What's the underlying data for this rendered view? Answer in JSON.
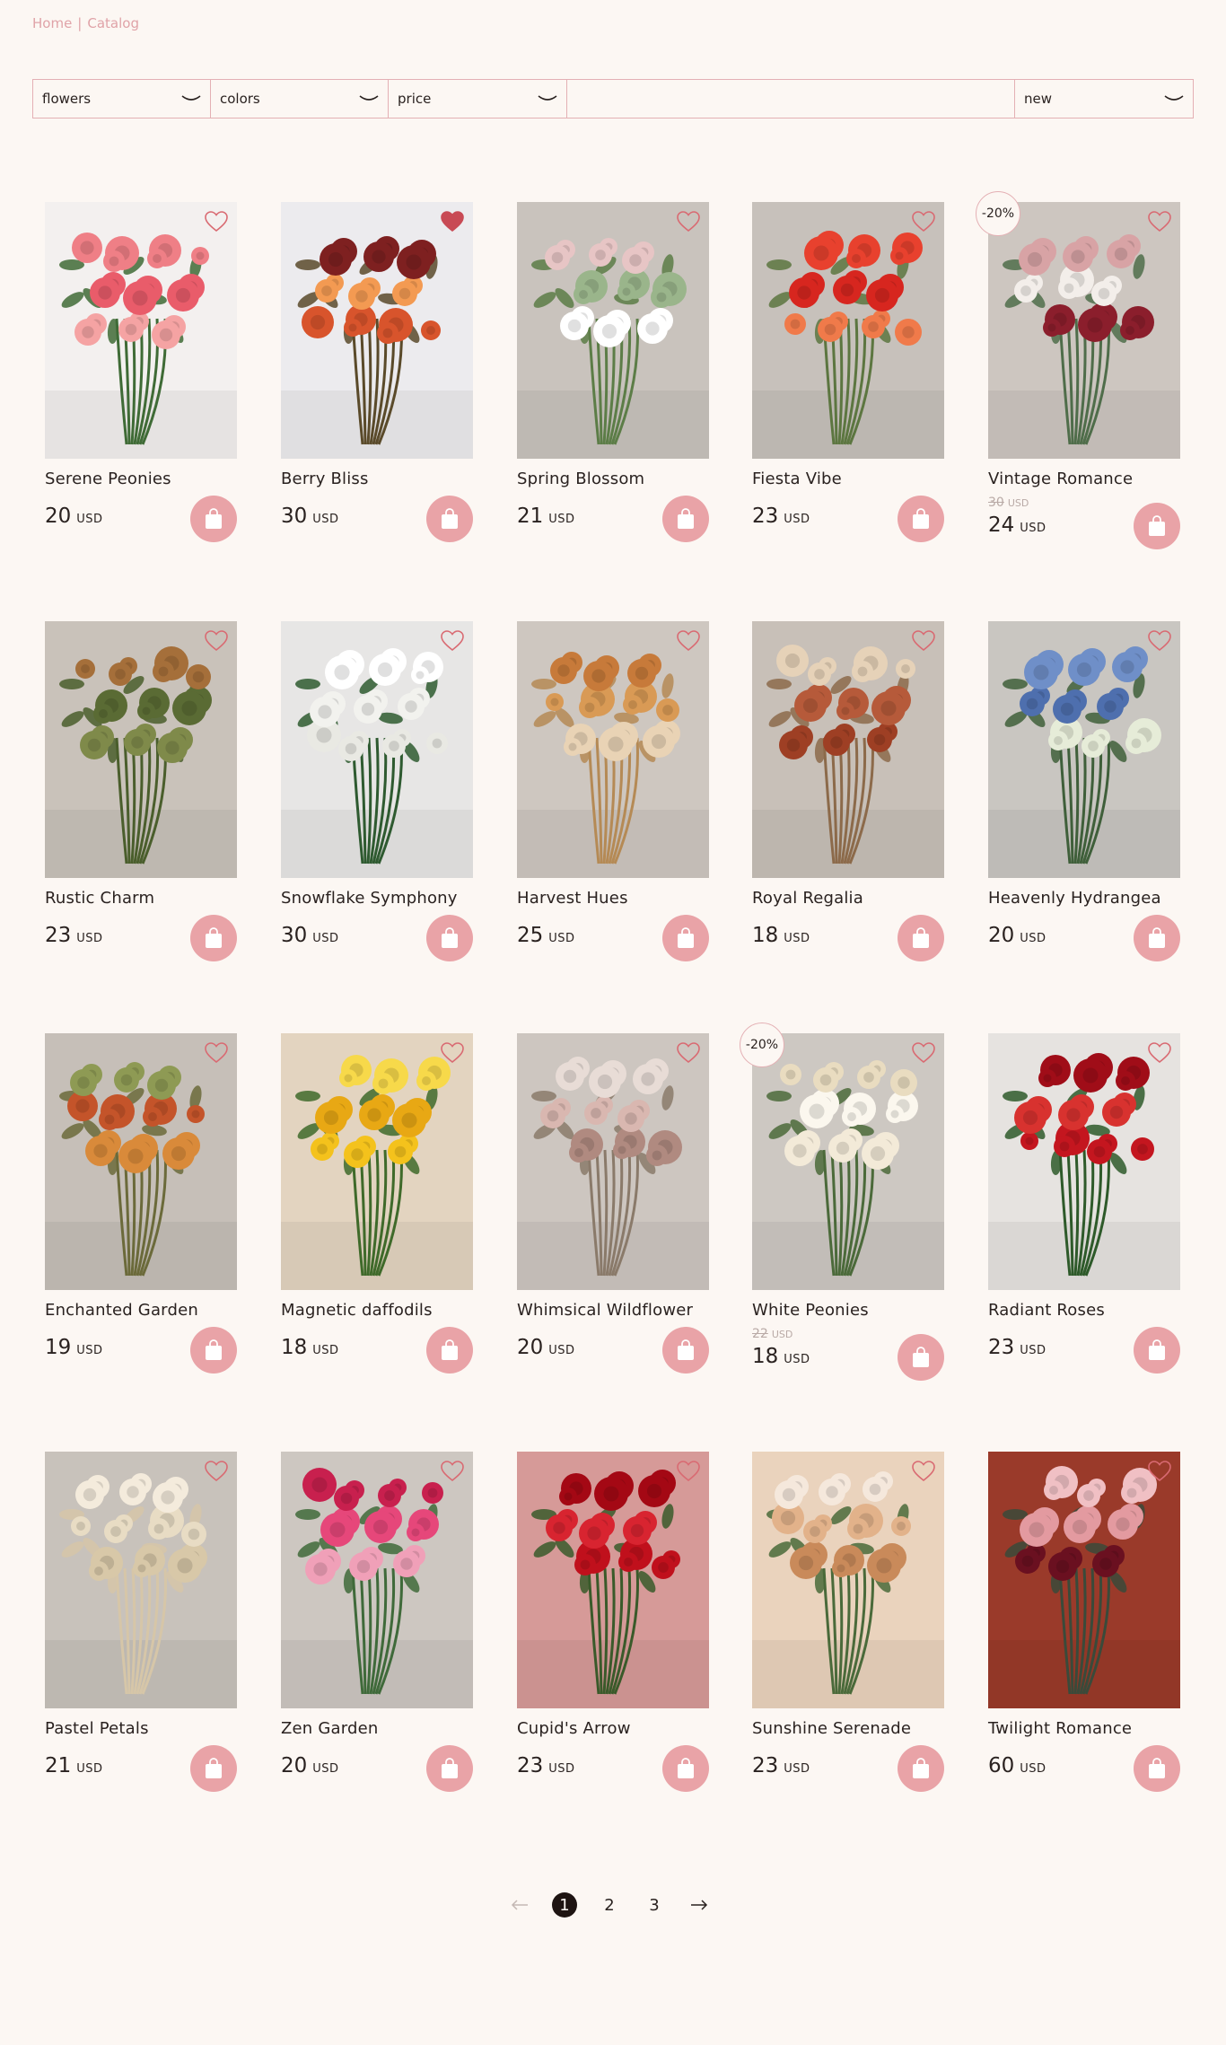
{
  "breadcrumb": {
    "home": "Home",
    "separator": "|",
    "current": "Catalog"
  },
  "filters": {
    "flowers": "flowers",
    "colors": "colors",
    "price": "price",
    "sort": "new"
  },
  "colors": {
    "accent": "#e9a3a7",
    "border": "#e4b0b4",
    "background": "#fcf7f3",
    "text": "#2a2220",
    "heart_filled": "#c84a55"
  },
  "currency": "USD",
  "products": [
    {
      "name": "Serene Peonies",
      "price": "20",
      "liked": false,
      "bg": "#f3f0ef",
      "bloom": [
        "#ef7f86",
        "#e95c6a",
        "#f5a3a3"
      ],
      "leaf": "#3f6b36"
    },
    {
      "name": "Berry Bliss",
      "price": "30",
      "liked": true,
      "bg": "#ecebee",
      "bloom": [
        "#f39a52",
        "#d8542c",
        "#7e2020"
      ],
      "leaf": "#5a4a2a"
    },
    {
      "name": "Spring Blossom",
      "price": "21",
      "liked": false,
      "bg": "#c9c3bd",
      "bloom": [
        "#ffffff",
        "#e7c5c5",
        "#9ab58b"
      ],
      "leaf": "#5c7d47"
    },
    {
      "name": "Fiesta Vibe",
      "price": "23",
      "liked": false,
      "bg": "#c7c1bb",
      "bloom": [
        "#e8412e",
        "#d7261f",
        "#f07a4a"
      ],
      "leaf": "#5c7640"
    },
    {
      "name": "Vintage Romance",
      "price": "24",
      "old_price": "30",
      "discount": "-20%",
      "liked": false,
      "bg": "#cdc6c0",
      "bloom": [
        "#f3eeea",
        "#8b1e2c",
        "#d8a3a5"
      ],
      "leaf": "#4f6d4a"
    },
    {
      "name": "Rustic Charm",
      "price": "23",
      "liked": false,
      "bg": "#c9c2ba",
      "bloom": [
        "#7f8a4a",
        "#a56f3a",
        "#5a6b34"
      ],
      "leaf": "#4a5e2c"
    },
    {
      "name": "Snowflake Symphony",
      "price": "30",
      "liked": false,
      "bg": "#e7e6e5",
      "bloom": [
        "#ffffff",
        "#f2f2ee",
        "#e9e9e3"
      ],
      "leaf": "#2e5a30"
    },
    {
      "name": "Harvest Hues",
      "price": "25",
      "liked": false,
      "bg": "#cec7c0",
      "bloom": [
        "#d99a55",
        "#e9d3b5",
        "#c77a3a"
      ],
      "leaf": "#b58a55"
    },
    {
      "name": "Royal Regalia",
      "price": "18",
      "liked": false,
      "bg": "#c8c0b8",
      "bloom": [
        "#9e3f24",
        "#e6d2b8",
        "#b65a3a"
      ],
      "leaf": "#8c6a4a"
    },
    {
      "name": "Heavenly Hydrangea",
      "price": "20",
      "liked": false,
      "bg": "#c9c6c1",
      "bloom": [
        "#6f8fc8",
        "#4e6fae",
        "#e6ecd8"
      ],
      "leaf": "#3f5f3a"
    },
    {
      "name": "Enchanted Garden",
      "price": "19",
      "liked": false,
      "bg": "#c6bfb8",
      "bloom": [
        "#c4542a",
        "#d98a3a",
        "#8e9a54"
      ],
      "leaf": "#6b6a3a"
    },
    {
      "name": "Magnetic daffodils",
      "price": "18",
      "liked": false,
      "bg": "#e3d4c0",
      "bloom": [
        "#f4c21c",
        "#f7d94a",
        "#e8a814"
      ],
      "leaf": "#3f6a2a"
    },
    {
      "name": "Whimsical Wildflower",
      "price": "20",
      "liked": false,
      "bg": "#cdc6c0",
      "bloom": [
        "#e8dcd6",
        "#d9b7b0",
        "#b08a80"
      ],
      "leaf": "#8a7a6a"
    },
    {
      "name": "White Peonies",
      "price": "18",
      "old_price": "22",
      "discount": "-20%",
      "liked": false,
      "bg": "#cdc8c2",
      "bloom": [
        "#fbf7ee",
        "#f3ead8",
        "#e9dcc0"
      ],
      "leaf": "#4b6a3a"
    },
    {
      "name": "Radiant Roses",
      "price": "23",
      "liked": false,
      "bg": "#e6e3e0",
      "bloom": [
        "#c4161f",
        "#a00d18",
        "#d8322f"
      ],
      "leaf": "#2e5a2a"
    },
    {
      "name": "Pastel Petals",
      "price": "21",
      "liked": false,
      "bg": "#c8c2bb",
      "bloom": [
        "#f4ebdc",
        "#e8dcc4",
        "#d8c8a8"
      ],
      "leaf": "#d6c6a8"
    },
    {
      "name": "Zen Garden",
      "price": "20",
      "liked": false,
      "bg": "#cdc7c1",
      "bloom": [
        "#e6477a",
        "#f0a0b8",
        "#c8204e"
      ],
      "leaf": "#3f6a3a"
    },
    {
      "name": "Cupid's Arrow",
      "price": "23",
      "liked": false,
      "bg": "#d69a98",
      "bloom": [
        "#c0101c",
        "#a40814",
        "#d82430"
      ],
      "leaf": "#3a5a2a"
    },
    {
      "name": "Sunshine Serenade",
      "price": "23",
      "liked": false,
      "bg": "#ead3bd",
      "bloom": [
        "#f5e8dc",
        "#e2b28a",
        "#c98a5a"
      ],
      "leaf": "#4a6a3a"
    },
    {
      "name": "Twilight Romance",
      "price": "60",
      "liked": false,
      "bg": "#9a3a2a",
      "bloom": [
        "#e39aa0",
        "#6a1020",
        "#f0c0c4"
      ],
      "leaf": "#3a4a3a"
    }
  ],
  "pagination": {
    "pages": [
      "1",
      "2",
      "3"
    ],
    "current": "1"
  }
}
